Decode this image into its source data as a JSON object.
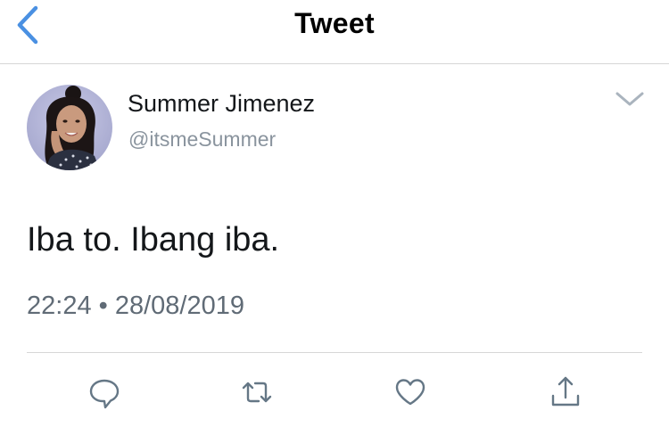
{
  "header": {
    "title": "Tweet",
    "back_icon": "chevron-left-icon",
    "accent_color": "#4a90e2"
  },
  "tweet": {
    "author": {
      "display_name": "Summer Jimenez",
      "handle": "@itsmeSummer",
      "avatar_icon": "user-avatar"
    },
    "menu_icon": "chevron-down-icon",
    "text": "Iba to. Ibang iba.",
    "timestamp": "22:24 • 28/08/2019"
  },
  "actions": [
    {
      "name": "reply",
      "icon": "reply-icon"
    },
    {
      "name": "retweet",
      "icon": "retweet-icon"
    },
    {
      "name": "like",
      "icon": "heart-icon"
    },
    {
      "name": "share",
      "icon": "share-icon"
    }
  ],
  "colors": {
    "text": "#14171a",
    "secondary_text": "#606b76",
    "handle": "#8a949e",
    "divider": "#d6d6d6",
    "icon": "#657786"
  }
}
